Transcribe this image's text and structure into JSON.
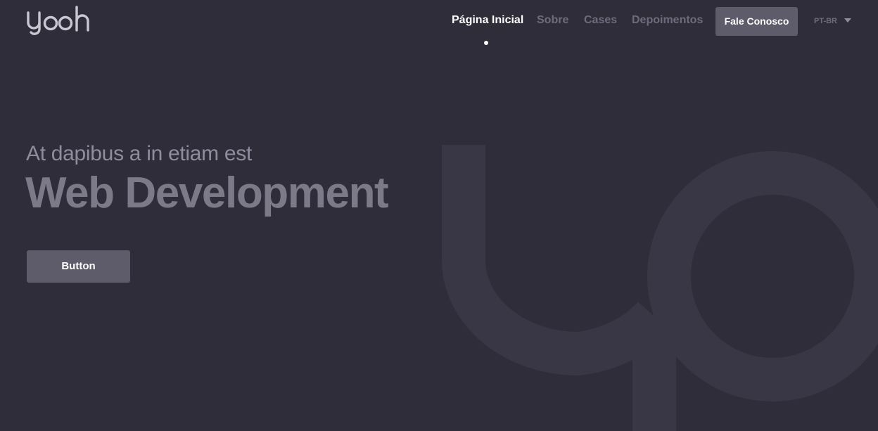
{
  "brand": {
    "logo_text": "yooh"
  },
  "nav": {
    "items": [
      {
        "label": "Página Inicial",
        "active": true
      },
      {
        "label": "Sobre",
        "active": false
      },
      {
        "label": "Cases",
        "active": false
      },
      {
        "label": "Depoimentos",
        "active": false
      }
    ],
    "cta_label": "Fale Conosco",
    "language": "PT-BR"
  },
  "hero": {
    "kicker": "At dapibus a in etiam est",
    "title": "Web Development",
    "button_label": "Button"
  },
  "colors": {
    "background": "#302d3b",
    "button": "#5e5b6b",
    "nav_inactive": "#6e6b7c",
    "title": "#7c7989"
  }
}
